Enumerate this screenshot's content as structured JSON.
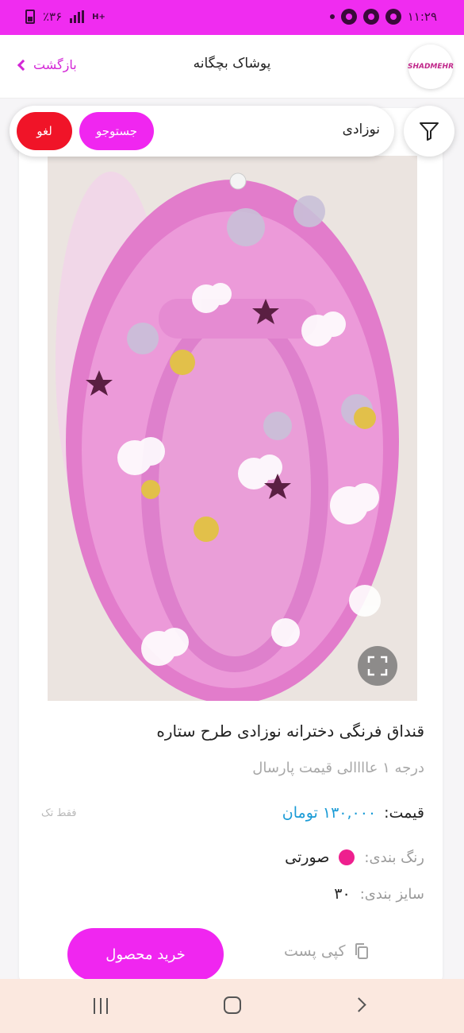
{
  "status_bar": {
    "battery_text": "٪۳۶",
    "network_text": "H+",
    "time": "۱۱:۲۹"
  },
  "header": {
    "title": "پوشاک بچگانه",
    "back_label": "بازگشت",
    "logo_text": "SHADMEHR"
  },
  "search": {
    "query": "نوزادی",
    "search_button": "جستوجو",
    "cancel_button": "لغو"
  },
  "product": {
    "title": "قنداق فرنگی دخترانه نوزادی طرح ستاره",
    "subtitle": "درجه ۱ عاااالی قیمت پارسال",
    "price_label": "قیمت:",
    "price_value": "۱۳۰,۰۰۰ تومان",
    "single_note": "فقط تک",
    "color_label": "رنگ بندی:",
    "color_value": "صورتی",
    "color_hex": "#ee1f8e",
    "size_label": "سایز بندی:",
    "size_value": "۳۰"
  },
  "actions": {
    "buy_button": "خرید محصول",
    "copy_post": "کپی پست"
  },
  "theme": {
    "accent": "#f026f0",
    "cancel": "#f01428",
    "price": "#1a9bd6"
  }
}
